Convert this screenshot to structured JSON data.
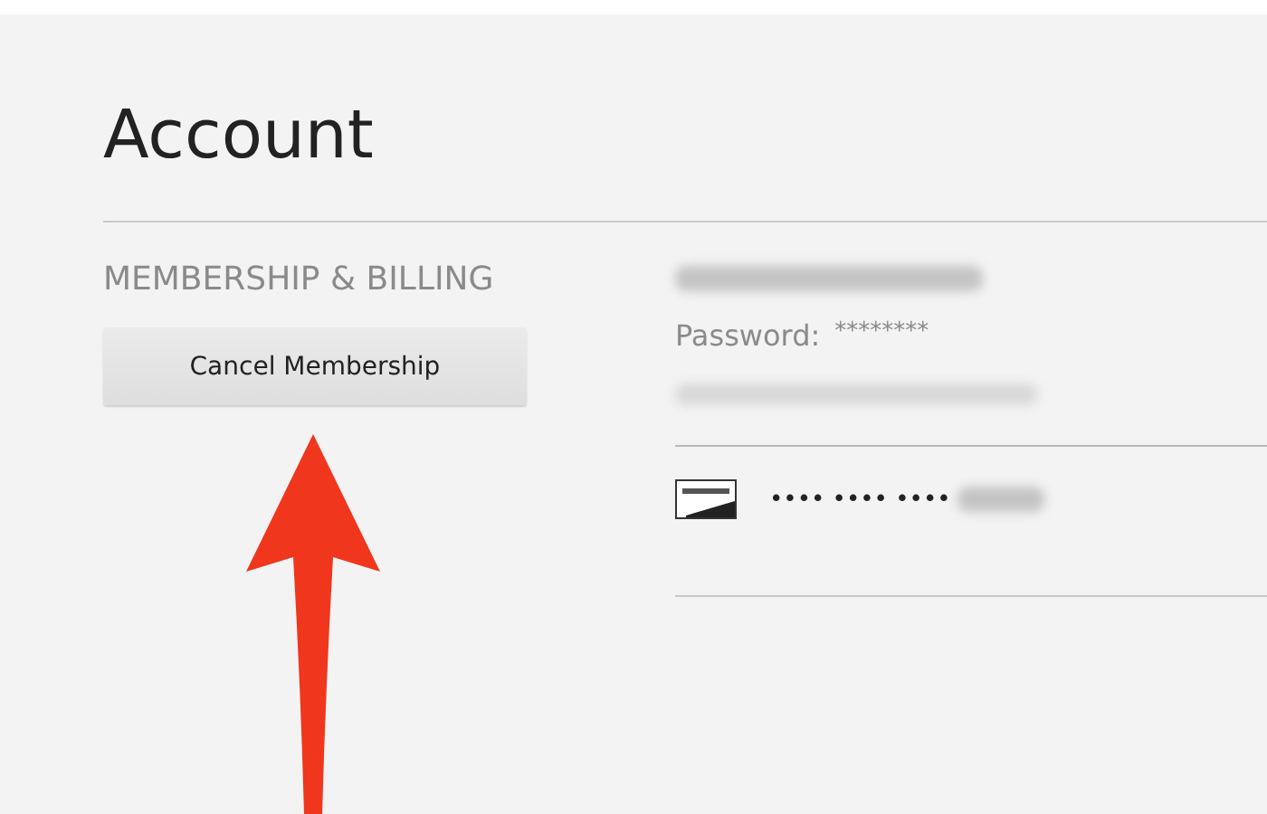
{
  "page_title": "Account",
  "membership": {
    "heading": "MEMBERSHIP & BILLING",
    "cancel_button": "Cancel Membership"
  },
  "details": {
    "password_label": "Password:",
    "password_value": "********",
    "card_number": "•••• •••• ••••"
  }
}
